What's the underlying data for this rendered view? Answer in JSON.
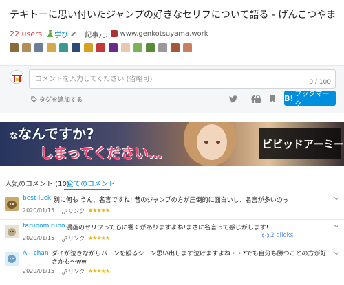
{
  "entry": {
    "title": "テキトーに思い付いたジャンプの好きなセリフについて語る - げんこつやま",
    "users": "22 users",
    "category": "学び",
    "source_label": "記事元:",
    "source": "www.genkotsuyama.work"
  },
  "composer": {
    "placeholder": "コメントを入力してください (省略可)",
    "counter": "0 / 100",
    "add_tag": "タグを追加する",
    "bookmark_b": "B!",
    "bookmark_label": "ブックマーク"
  },
  "banner": {
    "line1": "なんですか?",
    "line1_prefix": "な",
    "line2": "しまってください…",
    "brand": "ビビッドアーミー"
  },
  "tabs": [
    {
      "label": "人気のコメント (10)"
    },
    {
      "label": "全てのコメント"
    }
  ],
  "comments": [
    {
      "user": "best-luck",
      "text": "別に何も うん、名言ですね! 昔のジャンプの方が圧倒的に面白いし、名言が多いのぅ",
      "date": "2020/01/15",
      "link": "リンク",
      "stars": "★★★★★"
    },
    {
      "user": "tarubomirubo",
      "text": "漫画のセリフって心に響くがありますよね!まさに名言って感じがします!",
      "date": "2020/01/15",
      "link": "リンク",
      "stars": "★★★★★",
      "clicks": "2 clicks"
    },
    {
      "user": "A---chan",
      "text": "ダイが泣きながらバーンを殴るシーン思い出します泣けますよね・・*でも自分も勝つことの方が好きかも〜ww",
      "date": "2020/01/15",
      "link": "リンク",
      "stars": "★★★★★"
    }
  ],
  "colors": {
    "accent": "#008fde",
    "users": "#e3373b",
    "star": "#f0b400"
  }
}
